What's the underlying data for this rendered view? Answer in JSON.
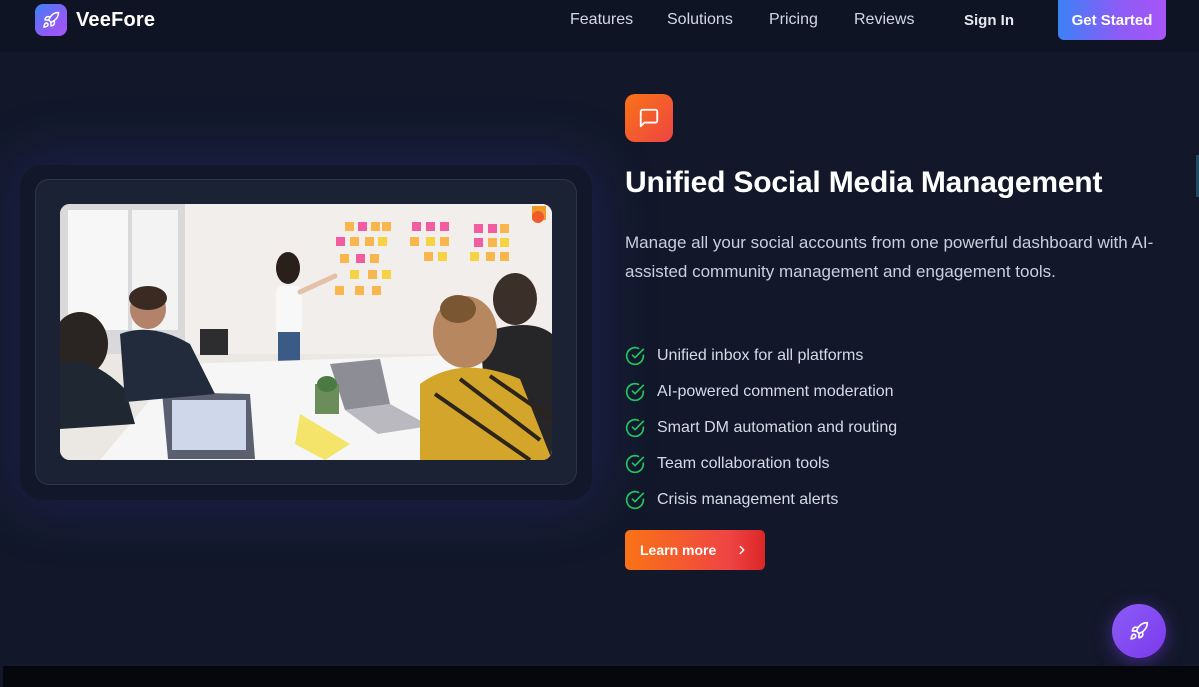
{
  "brand": {
    "name": "VeeFore",
    "icon": "rocket-icon"
  },
  "nav": {
    "links": [
      {
        "label": "Features"
      },
      {
        "label": "Solutions"
      },
      {
        "label": "Pricing"
      },
      {
        "label": "Reviews"
      }
    ],
    "sign_in": "Sign In",
    "cta": "Get Started"
  },
  "feature": {
    "icon": "chat-bubble-icon",
    "title": "Unified Social Media Management",
    "description": "Manage all your social accounts from one powerful dashboard with AI-assisted community management and engagement tools.",
    "bullets": [
      "Unified inbox for all platforms",
      "AI-powered comment moderation",
      "Smart DM automation and routing",
      "Team collaboration tools",
      "Crisis management alerts"
    ],
    "button": "Learn more"
  },
  "colors": {
    "background": "#121829",
    "accent_orange": "#f97316",
    "accent_red": "#ef4444",
    "accent_purple": "#8b5cf6",
    "check_green": "#22c55e"
  },
  "fab": {
    "icon": "rocket-icon"
  }
}
